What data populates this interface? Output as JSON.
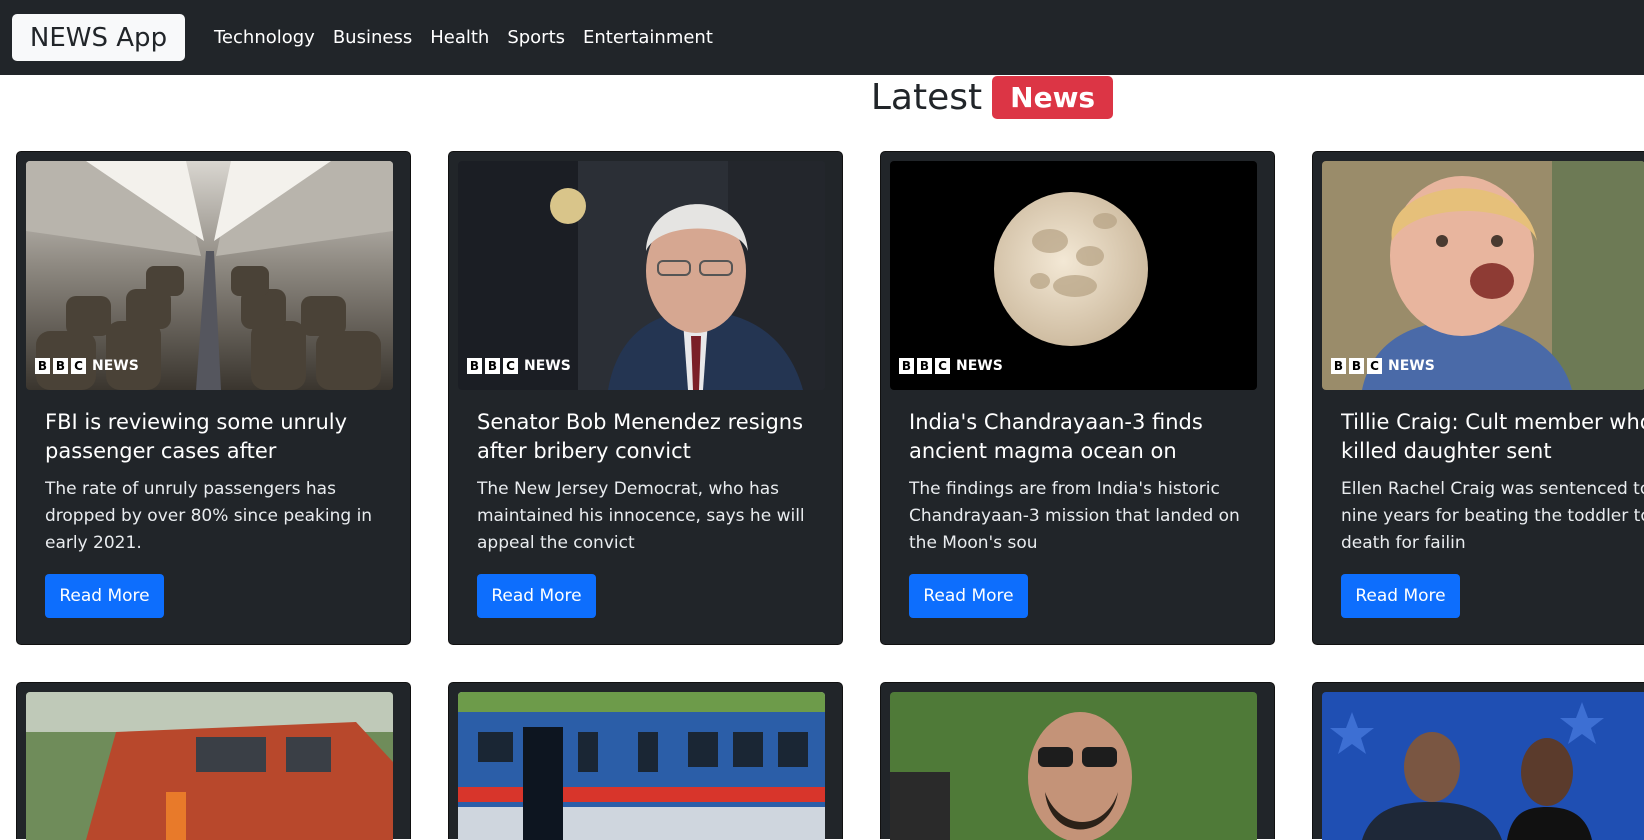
{
  "navbar": {
    "brand": "NEWS App",
    "links": [
      "Technology",
      "Business",
      "Health",
      "Sports",
      "Entertainment"
    ]
  },
  "heading": {
    "text": "Latest",
    "badge": "News"
  },
  "bbc_logo": {
    "letters": [
      "B",
      "B",
      "C"
    ],
    "label": "NEWS"
  },
  "cards": [
    {
      "title": "FBI is reviewing some unruly passenger cases after",
      "description": "The rate of unruly passengers has dropped by over 80% since peaking in early 2021.",
      "button": "Read More",
      "image": "airplane-cabin"
    },
    {
      "title": "Senator Bob Menendez resigns after bribery convict",
      "description": "The New Jersey Democrat, who has maintained his innocence, says he will appeal the convict",
      "button": "Read More",
      "image": "senator-portrait"
    },
    {
      "title": "India's Chandrayaan-3 finds ancient magma ocean on",
      "description": "The findings are from India's historic Chandrayaan-3 mission that landed on the Moon's sou",
      "button": "Read More",
      "image": "full-moon"
    },
    {
      "title": "Tillie Craig: Cult member who killed daughter sent",
      "description": "Ellen Rachel Craig was sentenced to nine years for beating the toddler to death for failin",
      "button": "Read More",
      "image": "toddler-photo"
    }
  ],
  "second_row_images": [
    "locomotive",
    "blue-train",
    "man-sunglasses",
    "stage-couple"
  ]
}
